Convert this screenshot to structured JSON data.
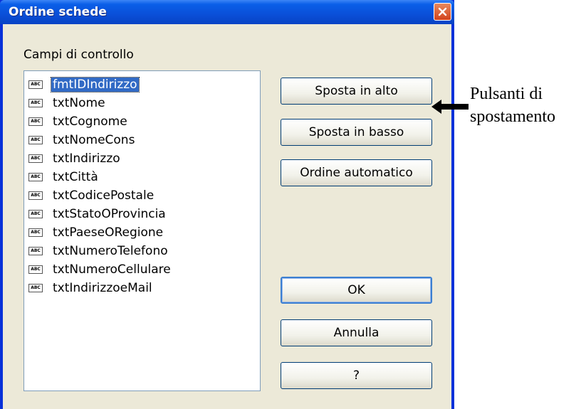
{
  "window": {
    "title": "Ordine schede"
  },
  "section": {
    "label": "Campi di controllo"
  },
  "list": {
    "icon_text": "ABC",
    "items": [
      "fmtIDIndirizzo",
      "txtNome",
      "txtCognome",
      "txtNomeCons",
      "txtIndirizzo",
      "txtCittà",
      "txtCodicePostale",
      "txtStatoOProvincia",
      "txtPaeseORegione",
      "txtNumeroTelefono",
      "txtNumeroCellulare",
      "txtIndirizzoeMail"
    ],
    "selected_item": "fmtIDIndirizzo"
  },
  "buttons": {
    "move_up": "Sposta in alto",
    "move_down": "Sposta in basso",
    "auto_order": "Ordine automatico",
    "ok": "OK",
    "cancel": "Annulla",
    "help": "?"
  },
  "annotation": {
    "line1": "Pulsanti di",
    "line2": "spostamento"
  },
  "colors": {
    "titlebar": "#0a55e0",
    "selection": "#316ac5",
    "dialog_face": "#ece9d8"
  }
}
